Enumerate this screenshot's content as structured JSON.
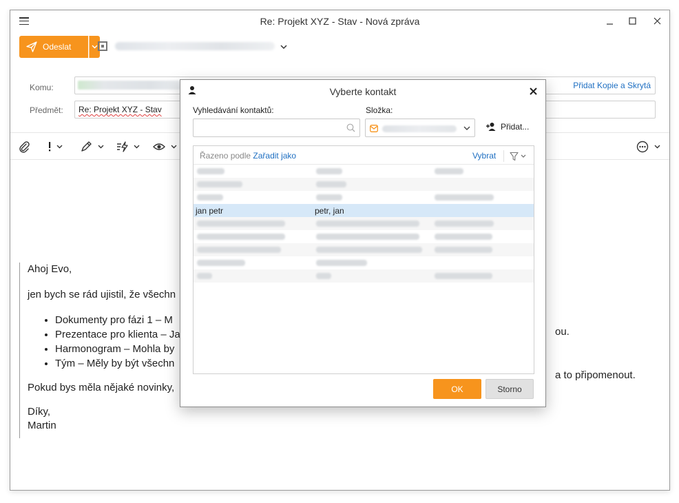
{
  "window": {
    "title": "Re: Projekt XYZ - Stav - Nová zpráva",
    "minimize": "—",
    "maximize": "☐",
    "close": "✕"
  },
  "send": {
    "label": "Odeslat"
  },
  "fields": {
    "to_label": "Komu:",
    "subject_label": "Předmět:",
    "subject_value": "Re: Projekt XYZ - Stav",
    "add_cc_bcc": "Přidat Kopie a Skrytá"
  },
  "body": {
    "greeting": "Ahoj Evo,",
    "intro": "jen bych se rád ujistil, že všechn",
    "bullets": [
      "Dokumenty pro fázi 1 – M",
      "Prezentace pro klienta – Ja",
      "Harmonogram – Mohla by",
      "Tým – Měly by být všechn"
    ],
    "bullet_tail_1": "ou.",
    "bullet_tail_4": "a to připomenout.",
    "closing_question": "Pokud bys měla nějaké novinky,",
    "thanks": "Díky,",
    "signature": "Martin"
  },
  "dialog": {
    "title": "Vyberte kontakt",
    "search_label": "Vyhledávání kontaktů:",
    "folder_label": "Složka:",
    "add_contact": "Přidat...",
    "sorted_by": "Řazeno podle ",
    "sort_as": "Zařadit jako",
    "select": "Vybrat",
    "selected_row": {
      "name": "jan petr",
      "file_as": "petr, jan"
    },
    "ok": "OK",
    "cancel": "Storno"
  },
  "colors": {
    "accent": "#f7941d",
    "link": "#1e6fc2",
    "selection": "#d6e8f8"
  }
}
